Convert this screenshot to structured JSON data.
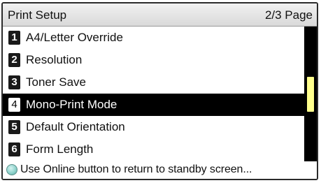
{
  "header": {
    "title": "Print Setup",
    "page_indicator": "2/3 Page"
  },
  "menu": {
    "items": [
      {
        "number": "1",
        "label": "A4/Letter Override"
      },
      {
        "number": "2",
        "label": "Resolution"
      },
      {
        "number": "3",
        "label": "Toner Save"
      },
      {
        "number": "4",
        "label": "Mono-Print Mode"
      },
      {
        "number": "5",
        "label": "Default Orientation"
      },
      {
        "number": "6",
        "label": "Form Length"
      }
    ],
    "selected_index": 3
  },
  "scrollbar": {
    "position_fraction": 0.5,
    "thumb_color": "#ffff8c"
  },
  "footer": {
    "icon": "online-button-icon",
    "text": "Use Online button to return to standby screen..."
  },
  "colors": {
    "selected_background": "#000000",
    "selected_text": "#ffffff"
  }
}
